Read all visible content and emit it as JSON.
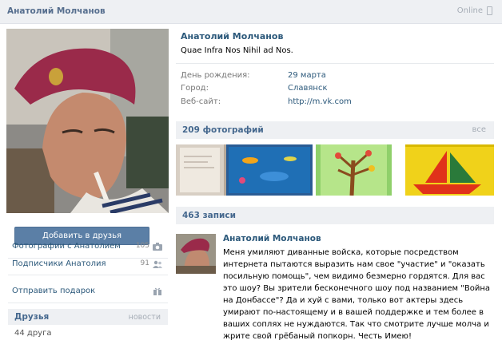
{
  "header": {
    "name": "Анатолий Молчанов",
    "status": "Online"
  },
  "left": {
    "add_friend_label": "Добавить в друзья",
    "links": [
      {
        "label": "Фотографии с Анатолием",
        "count": "105",
        "icon": "camera-icon"
      },
      {
        "label": "Подписчики Анатолия",
        "count": "91",
        "icon": "people-icon"
      },
      {
        "label": "Отправить подарок",
        "count": "",
        "icon": "gift-icon"
      }
    ],
    "friends": {
      "title": "Друзья",
      "news_link": "новости",
      "count": "44 друга"
    }
  },
  "profile": {
    "name": "Анатолий Молчанов",
    "status": "Quae Infra Nos Nihil ad Nos.",
    "info": [
      {
        "key": "День рождения:",
        "value": "29 марта"
      },
      {
        "key": "Город:",
        "value": "Славянск"
      },
      {
        "key": "Веб-сайт:",
        "value": "http://m.vk.com"
      }
    ]
  },
  "photos": {
    "title": "209 фотографий",
    "all_link": "все"
  },
  "wall": {
    "title": "463 записи",
    "post": {
      "author": "Анатолий Молчанов",
      "text": "Меня умиляют диванные войска, которые посредством интернета пытаются выразить нам свое \"участие\" и \"оказать посильную помощь\", чем видимо безмерно гордятся. Для вас это шоу? Вы зрители бесконечного шоу под названием \"Война на Донбассе\"? Да и хуй с вами, только вот актеры здесь умирают по-настоящему и в вашей поддержке и тем более в ваших соплях не нуждаются. Так что смотрите лучше молча и жрите свой грёбаный попкорн. Честь Имею!"
    }
  },
  "colors": {
    "link": "#2b587a",
    "header_bg": "#eef0f3",
    "button": "#5b7fa6",
    "beret": "#9a2a4a"
  }
}
